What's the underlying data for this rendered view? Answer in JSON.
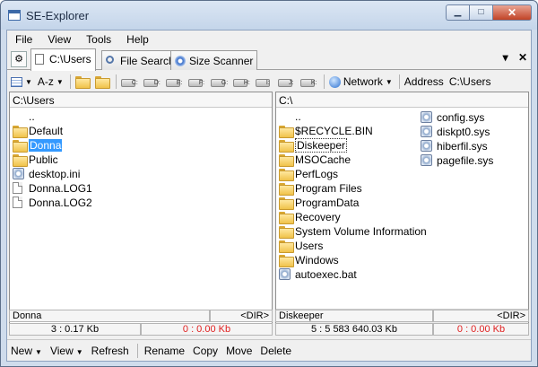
{
  "window": {
    "title": "SE-Explorer",
    "min": "▁",
    "max": "□",
    "close": "✕"
  },
  "menu": [
    "File",
    "View",
    "Tools",
    "Help"
  ],
  "tabs": [
    {
      "label": "C:\\Users",
      "icon": "page-icon"
    },
    {
      "label": "File Search",
      "icon": "magnifier-icon"
    },
    {
      "label": "Size Scanner",
      "icon": "disk-icon"
    }
  ],
  "tab_controls": {
    "dropdown": "▾",
    "close": "✕"
  },
  "toolbar": {
    "view_icon": "grid-view-icon",
    "sort": "A-z",
    "drives": [
      "C:",
      "D:",
      "E:",
      "F:",
      "G:",
      "H:",
      "I:",
      "J:",
      "K:"
    ],
    "network": "Network",
    "address_label": "Address",
    "address_value": "C:\\Users"
  },
  "left_panel": {
    "path": "C:\\Users",
    "items": [
      {
        "name": "..",
        "type": "up"
      },
      {
        "name": "Default",
        "type": "folder"
      },
      {
        "name": "Donna",
        "type": "folder",
        "selected": true
      },
      {
        "name": "Public",
        "type": "folder"
      },
      {
        "name": "desktop.ini",
        "type": "config"
      },
      {
        "name": "Donna.LOG1",
        "type": "file"
      },
      {
        "name": "Donna.LOG2",
        "type": "file"
      }
    ],
    "status_name": "Donna",
    "status_type": "<DIR>",
    "summary": "3 : 0.17 Kb",
    "selected_summary": "0 : 0.00 Kb"
  },
  "right_panel": {
    "path": "C:\\",
    "items": [
      {
        "name": "..",
        "type": "up"
      },
      {
        "name": "$RECYCLE.BIN",
        "type": "folder"
      },
      {
        "name": "Diskeeper",
        "type": "folder",
        "focused": true
      },
      {
        "name": "MSOCache",
        "type": "folder"
      },
      {
        "name": "PerfLogs",
        "type": "folder"
      },
      {
        "name": "Program Files",
        "type": "folder"
      },
      {
        "name": "ProgramData",
        "type": "folder"
      },
      {
        "name": "Recovery",
        "type": "folder"
      },
      {
        "name": "System Volume Information",
        "type": "folder"
      },
      {
        "name": "Users",
        "type": "folder"
      },
      {
        "name": "Windows",
        "type": "folder"
      },
      {
        "name": "autoexec.bat",
        "type": "config"
      }
    ],
    "items_col2": [
      {
        "name": "config.sys",
        "type": "config"
      },
      {
        "name": "diskpt0.sys",
        "type": "config"
      },
      {
        "name": "hiberfil.sys",
        "type": "config"
      },
      {
        "name": "pagefile.sys",
        "type": "config"
      }
    ],
    "status_name": "Diskeeper",
    "status_type": "<DIR>",
    "summary": "5 : 5 583 640.03 Kb",
    "selected_summary": "0 : 0.00 Kb"
  },
  "bottom": {
    "new": "New",
    "view": "View",
    "refresh": "Refresh",
    "rename": "Rename",
    "copy": "Copy",
    "move": "Move",
    "delete": "Delete"
  },
  "colors": {
    "selection": "#3399ff",
    "folder": "#f0c24a",
    "accent_red": "#e02020",
    "title_bg": "#c4d5ea"
  }
}
